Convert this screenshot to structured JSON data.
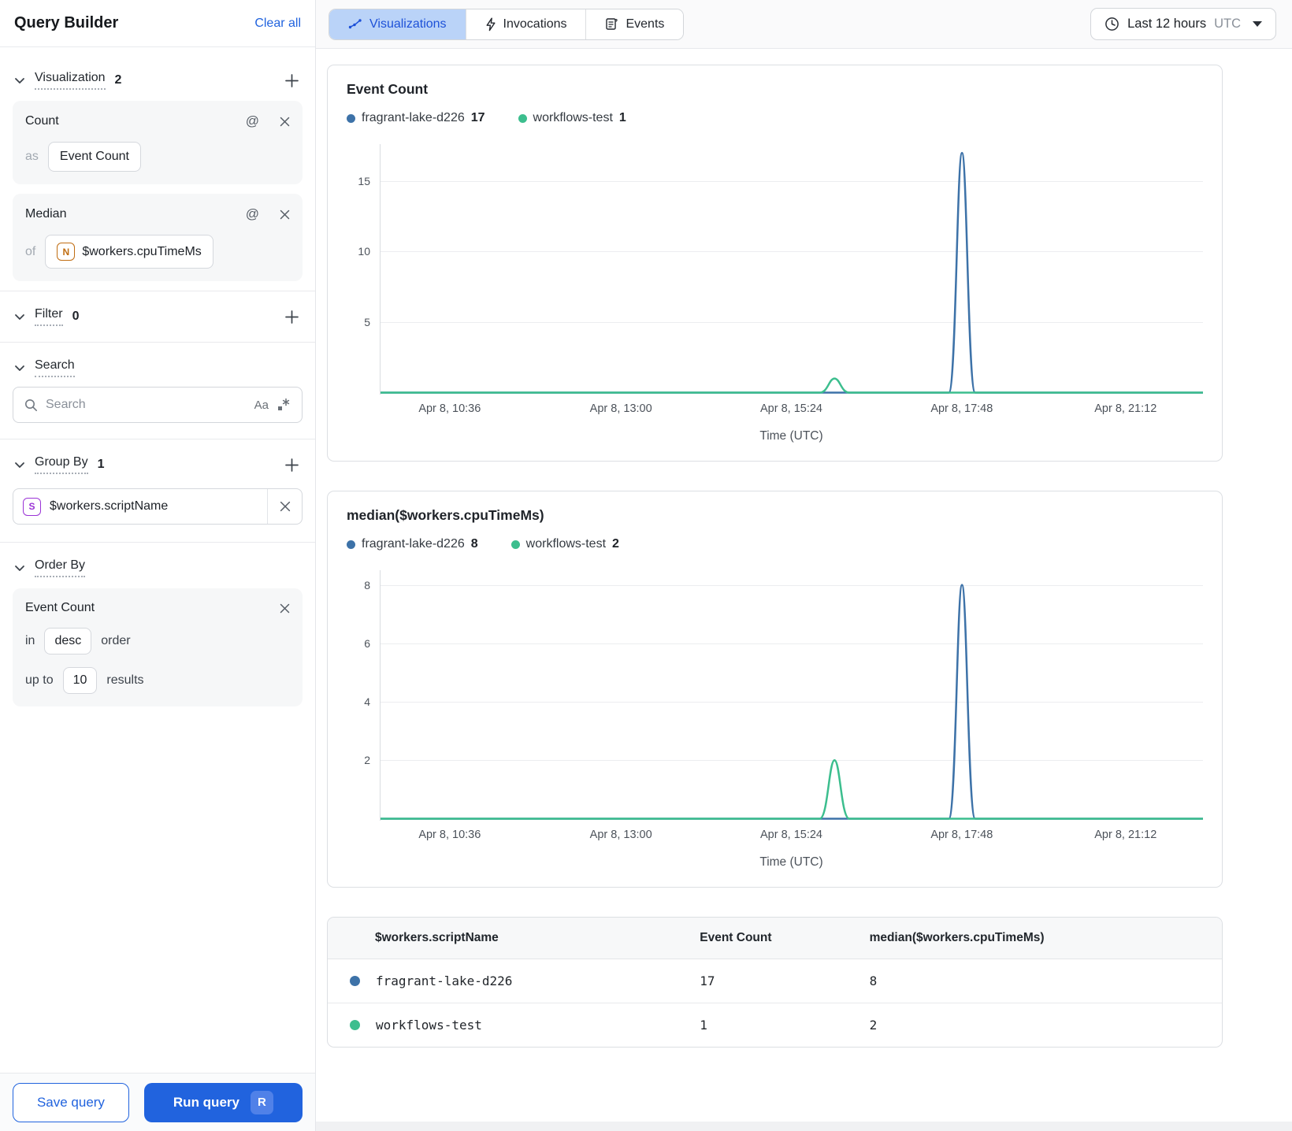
{
  "sidebar": {
    "title": "Query Builder",
    "clear_all": "Clear all",
    "visualization": {
      "label": "Visualization",
      "count": "2",
      "cards": [
        {
          "title": "Count",
          "as_label": "as",
          "value": "Event Count"
        },
        {
          "title": "Median",
          "of_label": "of",
          "field_icon": "N",
          "field": "$workers.cpuTimeMs"
        }
      ]
    },
    "filter": {
      "label": "Filter",
      "count": "0"
    },
    "search": {
      "label": "Search",
      "placeholder": "Search",
      "case_icon": "Aa"
    },
    "group_by": {
      "label": "Group By",
      "count": "1",
      "field_icon": "S",
      "field": "$workers.scriptName"
    },
    "order_by": {
      "label": "Order By",
      "card": {
        "title": "Event Count",
        "in_label": "in",
        "direction": "desc",
        "order_label": "order",
        "upto_label": "up to",
        "limit": "10",
        "results_label": "results"
      }
    },
    "save_button": "Save query",
    "run_button": "Run query",
    "run_shortcut": "R"
  },
  "header": {
    "tabs": [
      {
        "label": "Visualizations",
        "active": true
      },
      {
        "label": "Invocations",
        "active": false
      },
      {
        "label": "Events",
        "active": false
      }
    ],
    "time_range": {
      "label": "Last 12 hours",
      "timezone": "UTC"
    }
  },
  "chart_data": [
    {
      "type": "line",
      "title": "Event Count",
      "xlabel": "Time (UTC)",
      "legend": [
        {
          "name": "fragrant-lake-d226",
          "value": "17",
          "color": "#3d72a8"
        },
        {
          "name": "workflows-test",
          "value": "1",
          "color": "#3cbe8e"
        }
      ],
      "ylim": [
        0,
        17.2
      ],
      "y_grid": [
        5,
        10,
        15
      ],
      "grid": true,
      "legend_position": "top",
      "x_ticks": [
        {
          "label": "Apr 8, 10:36",
          "f": 0.085
        },
        {
          "label": "Apr 8, 13:00",
          "f": 0.293
        },
        {
          "label": "Apr 8, 15:24",
          "f": 0.5
        },
        {
          "label": "Apr 8, 17:48",
          "f": 0.707
        },
        {
          "label": "Apr 8, 21:12",
          "f": 0.906
        }
      ],
      "series": [
        {
          "name": "fragrant-lake-d226",
          "color": "#3d72a8",
          "baseline": 0,
          "spikes": [
            {
              "f": 0.707,
              "peak": 17,
              "halfwidth": 0.016
            }
          ]
        },
        {
          "name": "workflows-test",
          "color": "#3cbe8e",
          "baseline": 0,
          "spikes": [
            {
              "f": 0.552,
              "peak": 1,
              "halfwidth": 0.018
            }
          ]
        }
      ]
    },
    {
      "type": "line",
      "title": "median($workers.cpuTimeMs)",
      "xlabel": "Time (UTC)",
      "legend": [
        {
          "name": "fragrant-lake-d226",
          "value": "8",
          "color": "#3d72a8"
        },
        {
          "name": "workflows-test",
          "value": "2",
          "color": "#3cbe8e"
        }
      ],
      "ylim": [
        0,
        8.3
      ],
      "y_grid": [
        2,
        4,
        6,
        8
      ],
      "grid": true,
      "legend_position": "top",
      "x_ticks": [
        {
          "label": "Apr 8, 10:36",
          "f": 0.085
        },
        {
          "label": "Apr 8, 13:00",
          "f": 0.293
        },
        {
          "label": "Apr 8, 15:24",
          "f": 0.5
        },
        {
          "label": "Apr 8, 17:48",
          "f": 0.707
        },
        {
          "label": "Apr 8, 21:12",
          "f": 0.906
        }
      ],
      "series": [
        {
          "name": "fragrant-lake-d226",
          "color": "#3d72a8",
          "baseline": 0,
          "spikes": [
            {
              "f": 0.707,
              "peak": 8,
              "halfwidth": 0.016
            }
          ]
        },
        {
          "name": "workflows-test",
          "color": "#3cbe8e",
          "baseline": 0,
          "spikes": [
            {
              "f": 0.552,
              "peak": 2,
              "halfwidth": 0.018
            }
          ]
        }
      ]
    }
  ],
  "table": {
    "columns": [
      "$workers.scriptName",
      "Event Count",
      "median($workers.cpuTimeMs)"
    ],
    "rows": [
      {
        "color": "#3d72a8",
        "name": "fragrant-lake-d226",
        "values": [
          "17",
          "8"
        ]
      },
      {
        "color": "#3cbe8e",
        "name": "workflows-test",
        "values": [
          "1",
          "2"
        ]
      }
    ]
  },
  "colors": {
    "accent": "#2163de",
    "chart_blue": "#3d72a8",
    "chart_green": "#3cbe8e",
    "active_tab_bg": "#bad3f8"
  }
}
